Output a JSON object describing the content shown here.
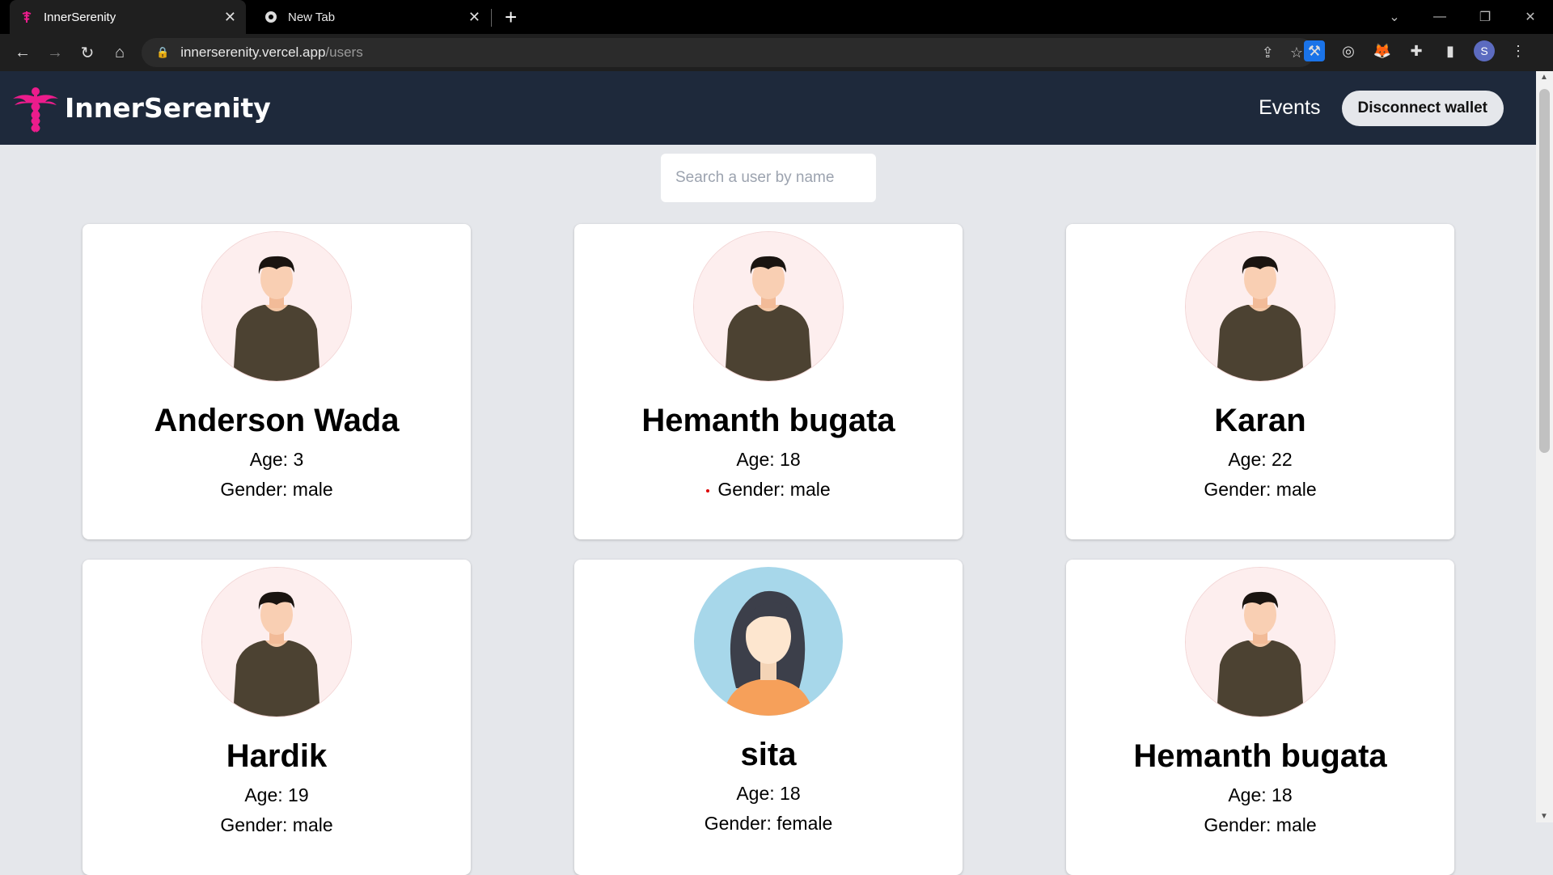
{
  "browser": {
    "tabs": [
      {
        "title": "InnerSerenity",
        "active": true
      },
      {
        "title": "New Tab",
        "active": false
      }
    ],
    "url_host": "innerserenity.vercel.app",
    "url_path": "/users",
    "profile_initial": "S"
  },
  "app": {
    "brand": "InnerSerenity",
    "nav": {
      "events": "Events",
      "disconnect": "Disconnect wallet"
    },
    "search_placeholder": "Search a user by name"
  },
  "users": [
    {
      "name": "Anderson Wada",
      "age": "Age: 3",
      "gender": "Gender: male",
      "avatar": "male"
    },
    {
      "name": "Hemanth bugata",
      "age": "Age: 18",
      "gender": "Gender: male",
      "avatar": "male"
    },
    {
      "name": "Karan",
      "age": "Age: 22",
      "gender": "Gender: male",
      "avatar": "male"
    },
    {
      "name": "Hardik",
      "age": "Age: 19",
      "gender": "Gender: male",
      "avatar": "male"
    },
    {
      "name": "sita",
      "age": "Age: 18",
      "gender": "Gender: female",
      "avatar": "female"
    },
    {
      "name": "Hemanth bugata",
      "age": "Age: 18",
      "gender": "Gender: male",
      "avatar": "male"
    }
  ],
  "colors": {
    "navbar": "#1e293b",
    "brand_pink": "#ec1c8c",
    "page_bg": "#e5e7eb"
  }
}
